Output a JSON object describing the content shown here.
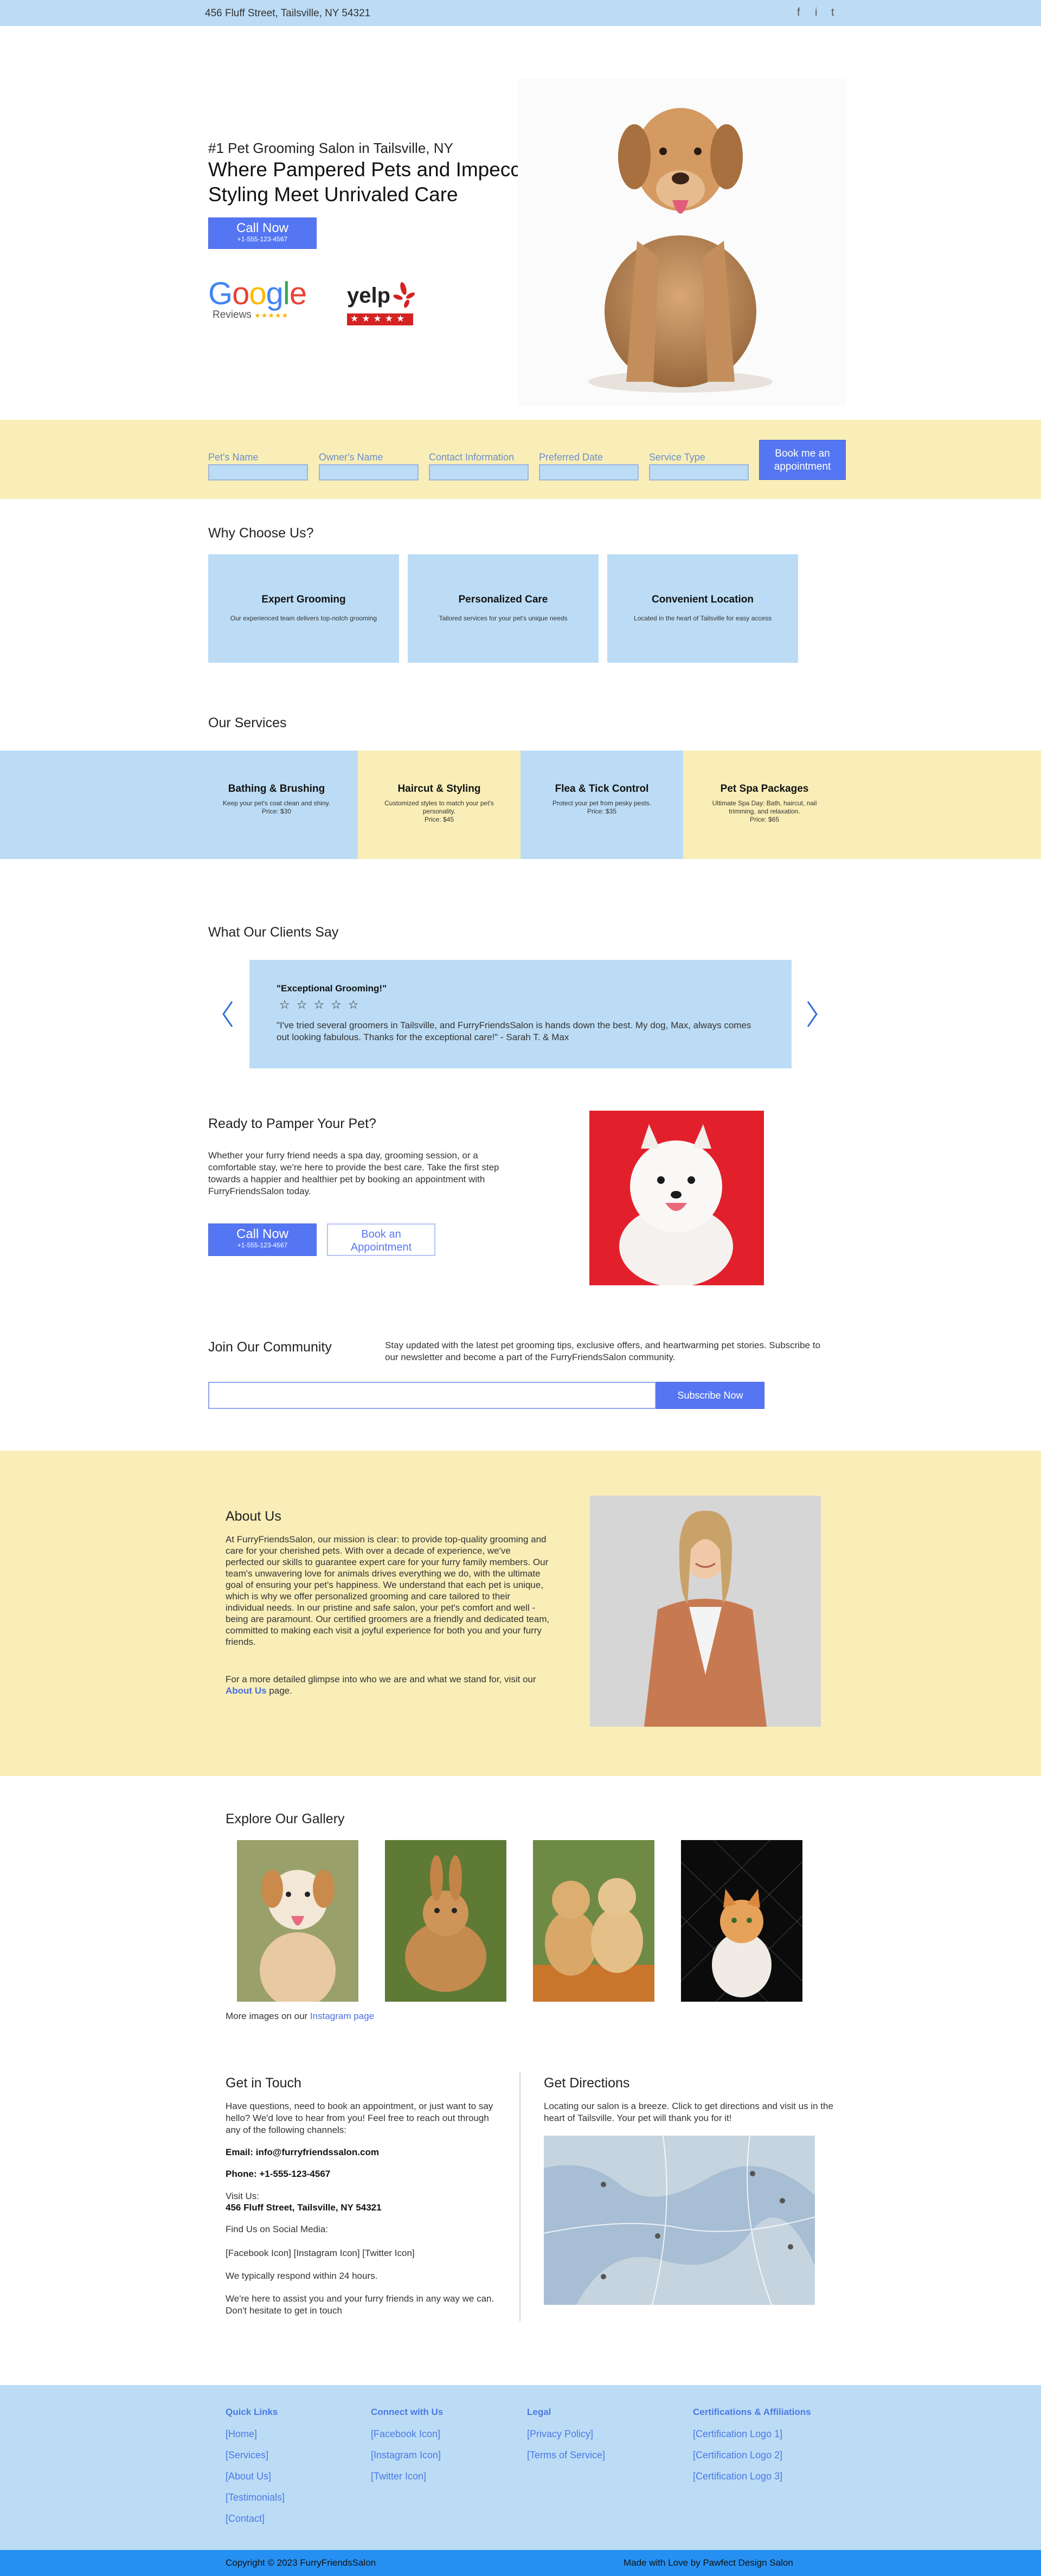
{
  "topbar": {
    "address": "456 Fluff Street, Tailsville, NY 54321",
    "social": [
      "f",
      "i",
      "t"
    ]
  },
  "hero": {
    "subtitle": "#1 Pet Grooming Salon in Tailsville, NY",
    "title": "Where Pampered Pets and Impeccable Styling Meet Unrivaled Care",
    "call_label": "Call Now",
    "call_phone": "+1-555-123-4567",
    "google_logo": "Google",
    "google_reviews": "Reviews",
    "google_stars": "★★★★★",
    "yelp_logo": "yelp",
    "yelp_stars": "★★★★★"
  },
  "booking": {
    "fields": [
      "Pet's Name",
      "Owner's Name",
      "Contact Information",
      "Preferred Date",
      "Service Type"
    ],
    "button": "Book me an appointment"
  },
  "why": {
    "heading": "Why Choose Us?",
    "cards": [
      {
        "title": "Expert Grooming",
        "desc": "Our experienced team delivers top-notch grooming"
      },
      {
        "title": "Personalized Care",
        "desc": "Tailored services for your pet's unique needs"
      },
      {
        "title": "Convenient Location",
        "desc": "Located in the heart of Tailsville for easy access"
      }
    ]
  },
  "services": {
    "heading": "Our Services",
    "colors": {
      "blue": "#bcdcf5",
      "yellow": "#f9eeb7"
    },
    "items": [
      {
        "title": "Bathing & Brushing",
        "desc": "Keep your pet's coat clean and shiny.",
        "price": "Price: $30"
      },
      {
        "title": "Haircut & Styling",
        "desc": "Customized styles to match your pet's personality.",
        "price": "Price: $45"
      },
      {
        "title": "Flea & Tick Control",
        "desc": "Protect your pet from pesky pests.",
        "price": "Price: $35"
      },
      {
        "title": "Pet Spa Packages",
        "desc": "Ultimate Spa Day: Bath, haircut, nail trimming, and relaxation.",
        "price": "Price: $65"
      }
    ]
  },
  "testimonials": {
    "heading": "What Our Clients Say",
    "title": "\"Exceptional Grooming!\"",
    "stars": "☆☆☆☆☆",
    "quote": "\"I've tried several groomers in Tailsville, and FurryFriendsSalon is hands down the best. My dog, Max, always comes out looking fabulous. Thanks for the exceptional care!\" - Sarah T. & Max"
  },
  "pamper": {
    "heading": "Ready to Pamper Your Pet?",
    "text": "Whether your furry friend needs a spa day, grooming session, or a comfortable stay, we're here to provide the best care. Take the first step towards a happier and healthier pet by booking an appointment with FurryFriendsSalon today.",
    "call_label": "Call Now",
    "call_phone": "+1-555-123-4567",
    "book_label": "Book an Appointment"
  },
  "community": {
    "heading": "Join Our Community",
    "text": "Stay updated with the latest pet grooming tips, exclusive offers, and heartwarming pet stories. Subscribe to our newsletter and become a part of the FurryFriendsSalon community.",
    "email_value": "",
    "button": "Subscribe Now"
  },
  "about": {
    "heading": "About Us",
    "text": "At FurryFriendsSalon, our mission is clear: to provide top-quality grooming and care for your cherished pets. With over a decade of experience, we've perfected our skills to guarantee expert care for your furry family members. Our team's unwavering love for animals drives everything we do, with the ultimate goal of ensuring your pet's happiness. We understand that each pet is unique, which is why we offer personalized grooming and care tailored to their individual needs. In our pristine and safe salon, your pet's comfort and well -being are paramount. Our certified groomers are a friendly and dedicated team, committed to making each visit a joyful experience for both you and your furry friends.",
    "more_prefix": "For a more detailed glimpse into who we are and what we stand for, visit our",
    "more_link": "About Us",
    "more_suffix": "page."
  },
  "gallery": {
    "heading": "Explore Our Gallery",
    "more_prefix": "More images on our",
    "more_link": "Instagram page"
  },
  "contact": {
    "heading": "Get in Touch",
    "intro": "Have questions, need to book an appointment, or just want to say hello? We'd love to hear from you! Feel free to reach out through any of the following channels:",
    "email_label": "Email:",
    "email": "info@furryfriendssalon.com",
    "phone_label": "Phone:",
    "phone": "+1-555-123-4567",
    "visit_label": "Visit Us:",
    "visit_address": "456 Fluff Street, Tailsville, NY 54321",
    "social_label": "Find Us on Social Media:",
    "social_links": "[Facebook Icon] [Instagram Icon] [Twitter Icon]",
    "respond": "We typically respond within 24 hours.",
    "closing": "We're here to assist you and your furry friends in any way we can. Don't hesitate to get in touch"
  },
  "directions": {
    "heading": "Get Directions",
    "text": "Locating our salon is a breeze. Click to get directions and visit us in the heart of Tailsville. Your pet will thank you for it!"
  },
  "footer": {
    "columns": [
      {
        "heading": "Quick Links",
        "items": [
          "[Home]",
          "[Services]",
          "[About Us]",
          "[Testimonials]",
          "[Contact]"
        ]
      },
      {
        "heading": "Connect with Us",
        "items": [
          "[Facebook Icon]",
          "[Instagram Icon]",
          "[Twitter Icon]"
        ]
      },
      {
        "heading": "Legal",
        "items": [
          "[Privacy Policy]",
          "[Terms of Service]"
        ]
      },
      {
        "heading": "Certifications & Affiliations",
        "items": [
          "[Certification Logo 1]",
          "[Certification Logo 2]",
          "[Certification Logo 3]"
        ]
      }
    ],
    "copyright": "Copyright © 2023 FurryFriendsSalon",
    "credit": "Made with Love by Pawfect Design Salon"
  }
}
